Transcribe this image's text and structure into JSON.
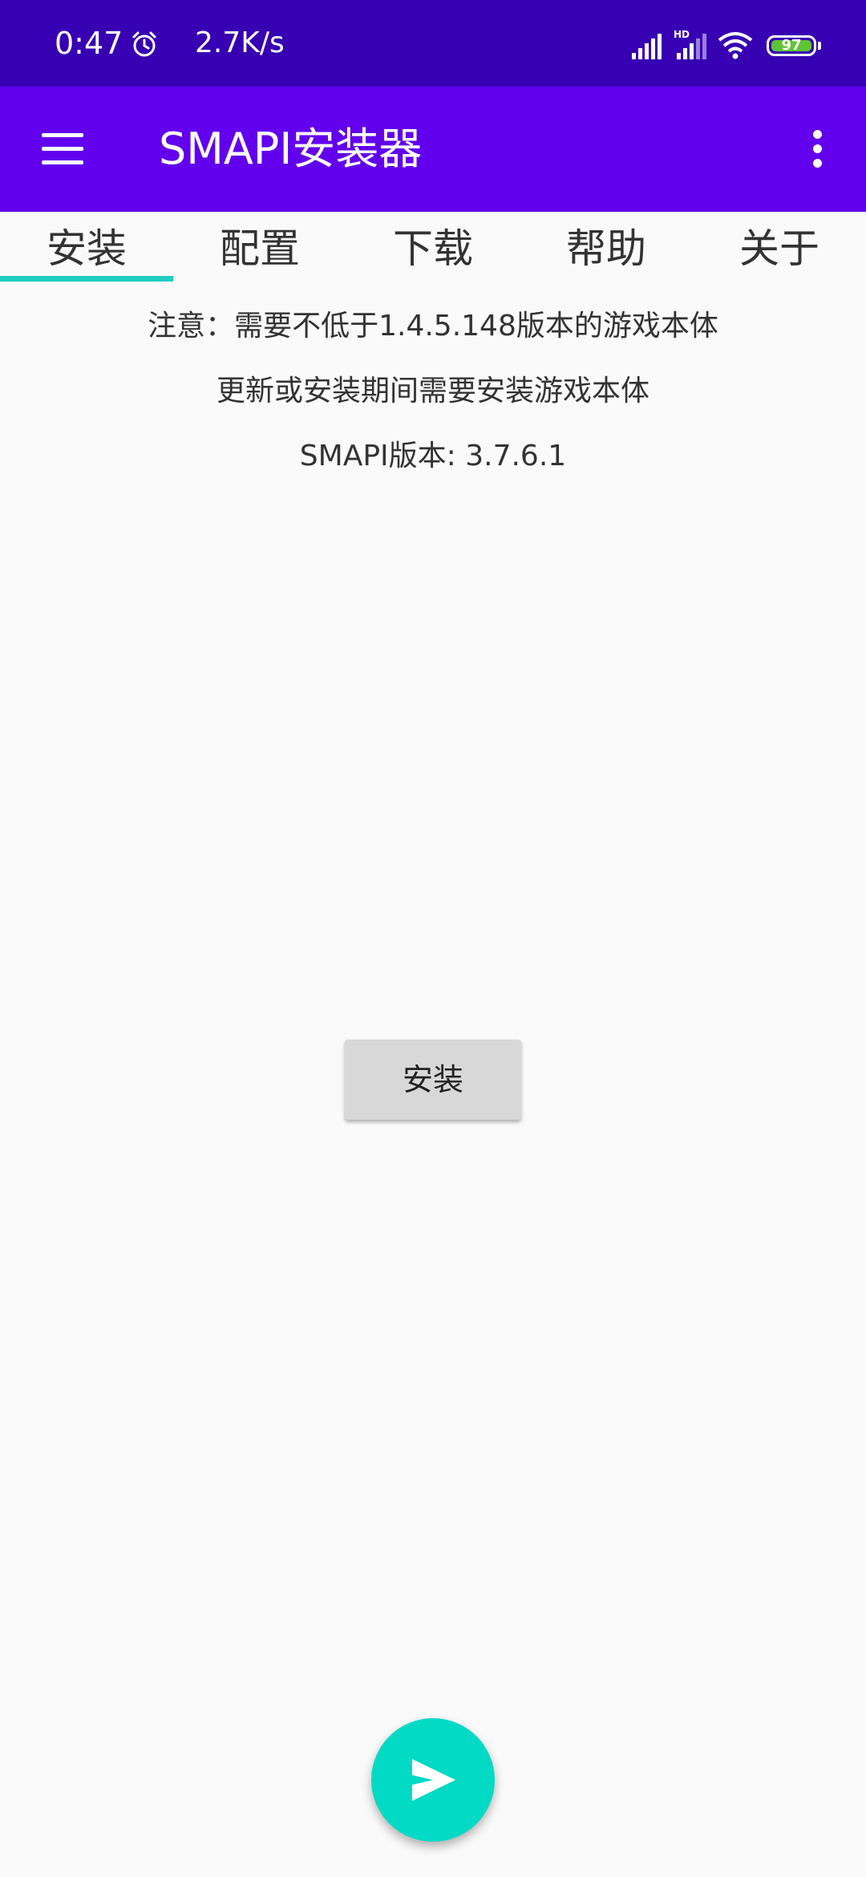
{
  "status_bar": {
    "time": "0:47",
    "network_speed": "2.7K/s",
    "battery_level": "97",
    "signal_hd_label": "HD",
    "icons": [
      "alarm-icon",
      "signal-icon",
      "signal-hd-icon",
      "wifi-icon",
      "battery-icon"
    ]
  },
  "app_bar": {
    "title": "SMAPI安装器",
    "menu_icon": "hamburger-menu-icon",
    "overflow_icon": "more-vertical-icon"
  },
  "tabs": [
    {
      "label": "安装",
      "selected": true
    },
    {
      "label": "配置",
      "selected": false
    },
    {
      "label": "下载",
      "selected": false
    },
    {
      "label": "帮助",
      "selected": false
    },
    {
      "label": "关于",
      "selected": false
    }
  ],
  "content": {
    "note_line1": "注意：需要不低于1.4.5.148版本的游戏本体",
    "note_line2": "更新或安装期间需要安装游戏本体",
    "version_line": "SMAPI版本: 3.7.6.1",
    "install_button": "安装"
  },
  "fab": {
    "icon": "send-icon"
  },
  "colors": {
    "status_bar": "#3700b3",
    "app_bar": "#6200ee",
    "accent": "#03dac5",
    "tab_indicator": "#1fcfc1",
    "background": "#fafafa"
  }
}
